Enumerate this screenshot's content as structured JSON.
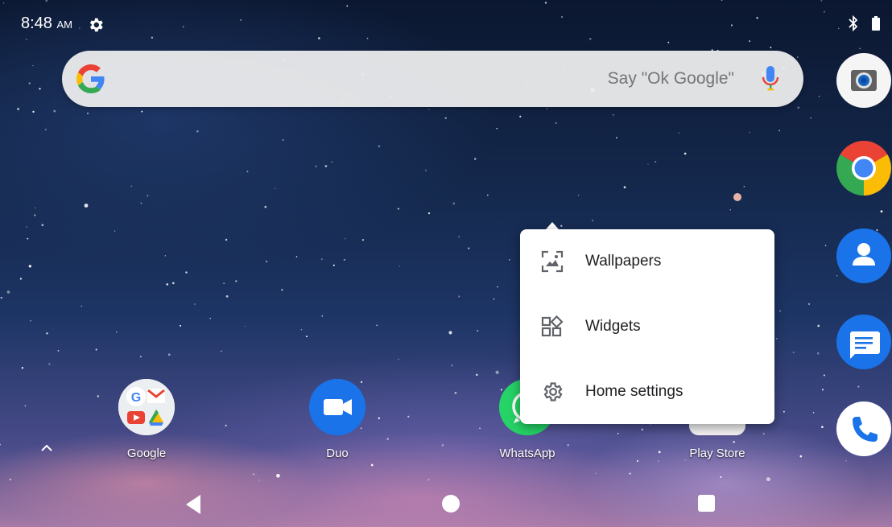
{
  "status_bar": {
    "time": "8:48",
    "ampm": "AM",
    "icons": [
      "settings-gear-icon",
      "bluetooth-icon",
      "battery-icon"
    ]
  },
  "search": {
    "hint": "Say \"Ok Google\"",
    "icons": [
      "google-g-icon",
      "microphone-icon"
    ]
  },
  "dock": [
    {
      "name": "camera",
      "icon": "camera-icon"
    },
    {
      "name": "chrome",
      "icon": "chrome-icon"
    },
    {
      "name": "contacts",
      "icon": "contacts-icon"
    },
    {
      "name": "messages",
      "icon": "messages-icon"
    },
    {
      "name": "phone",
      "icon": "phone-icon"
    }
  ],
  "apps": [
    {
      "label": "Google",
      "icon": "google-folder-icon"
    },
    {
      "label": "Duo",
      "icon": "duo-icon"
    },
    {
      "label": "WhatsApp",
      "icon": "whatsapp-icon"
    },
    {
      "label": "Play Store",
      "icon": "play-store-icon"
    }
  ],
  "popup_menu": {
    "items": [
      {
        "label": "Wallpapers",
        "icon": "wallpaper-icon"
      },
      {
        "label": "Widgets",
        "icon": "widgets-icon"
      },
      {
        "label": "Home settings",
        "icon": "settings-gear-icon"
      }
    ]
  },
  "nav_bar": {
    "icons": [
      "back-icon",
      "home-icon",
      "recents-icon"
    ]
  },
  "colors": {
    "google_blue": "#4285F4",
    "google_red": "#EA4335",
    "google_yellow": "#FBBC05",
    "google_green": "#34A853",
    "duo_blue": "#1A73E8",
    "whatsapp_green": "#25D366",
    "contacts_blue": "#1A73E8",
    "menu_icon_gray": "#5f6368"
  }
}
